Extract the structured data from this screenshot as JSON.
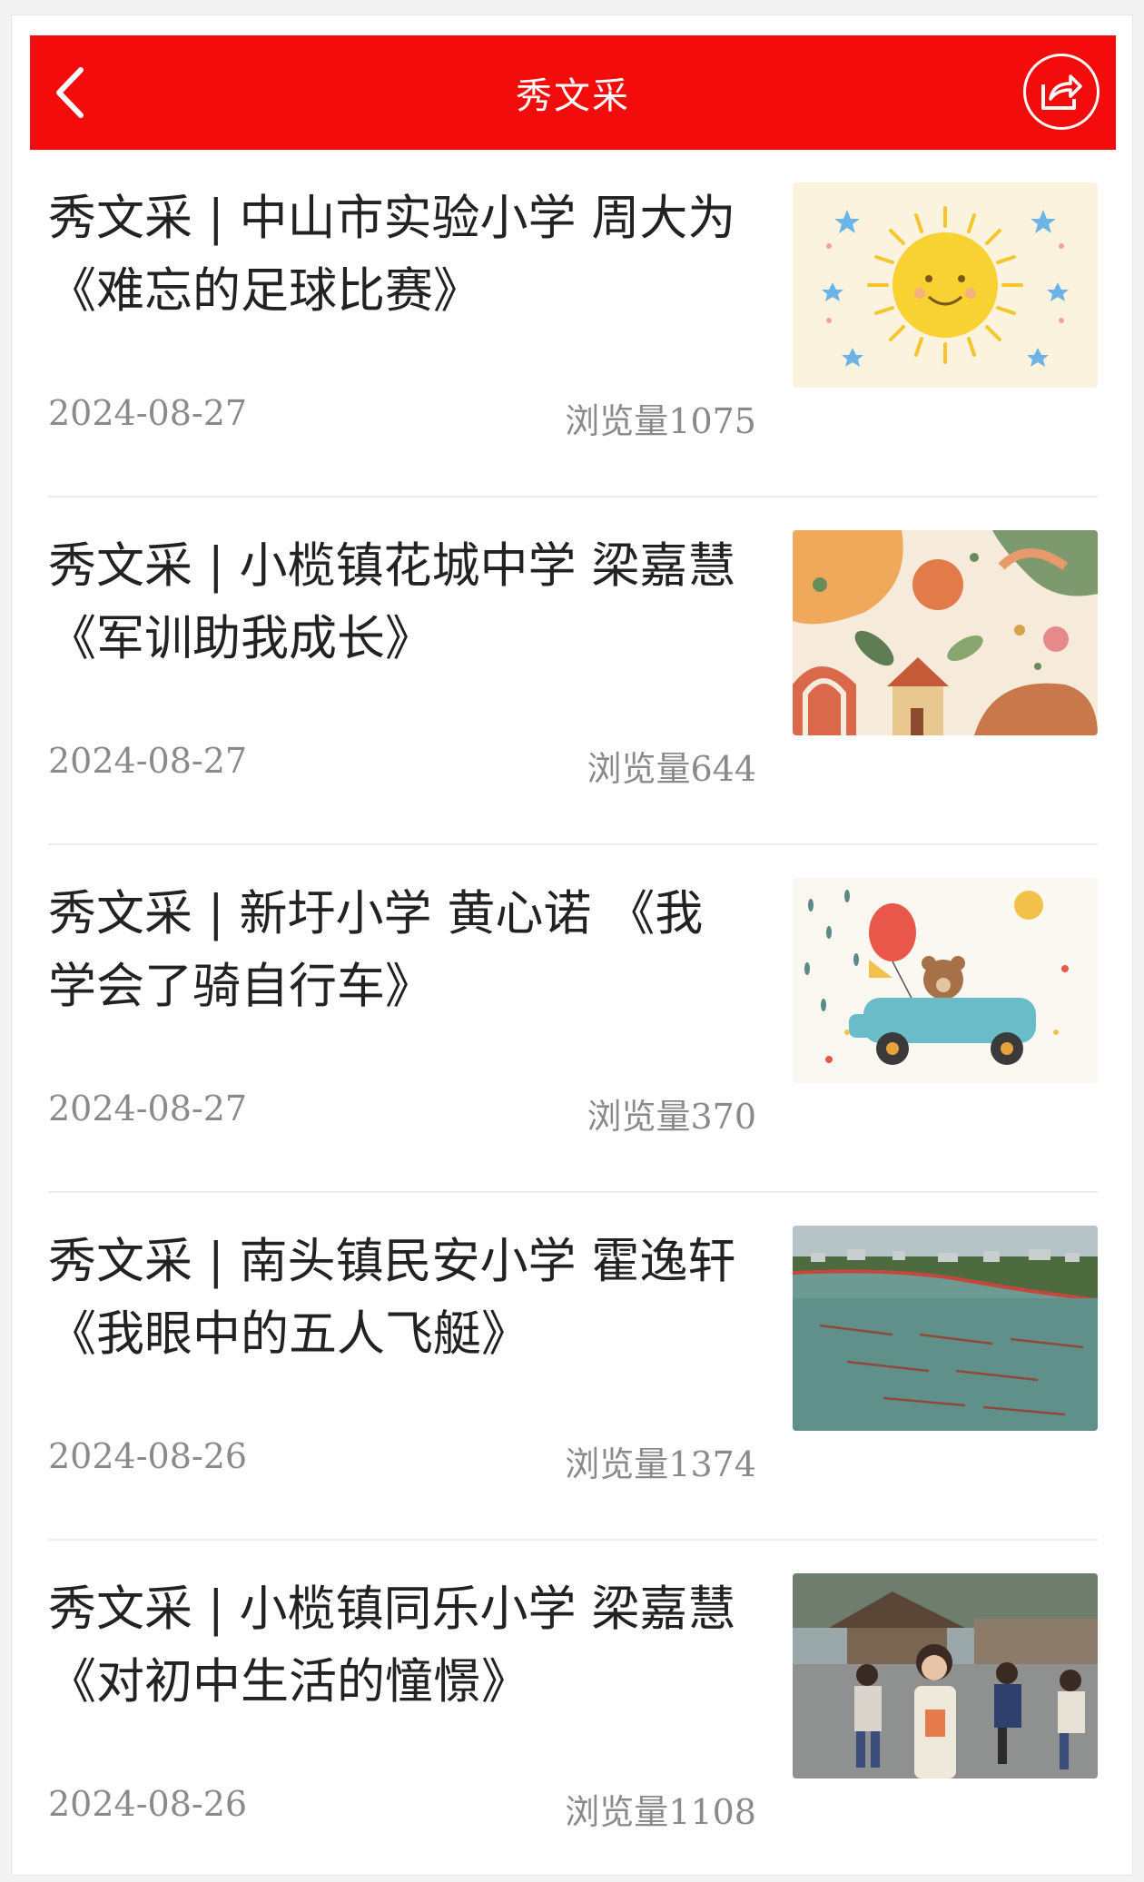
{
  "header": {
    "title": "秀文采",
    "brand_color": "#f40b0b"
  },
  "articles": [
    {
      "title": "秀文采 | 中山市实验小学 周大为 《难忘的足球比赛》",
      "date": "2024-08-27",
      "views": "浏览量1075",
      "thumbnail": "sun-illustration"
    },
    {
      "title": "秀文采 | 小榄镇花城中学 梁嘉慧 《军训助我成长》",
      "date": "2024-08-27",
      "views": "浏览量644",
      "thumbnail": "botanical-pattern"
    },
    {
      "title": "秀文采 | 新圩小学 黄心诺 《我学会了骑自行车》",
      "date": "2024-08-27",
      "views": "浏览量370",
      "thumbnail": "bear-car-illustration"
    },
    {
      "title": "秀文采 | 南头镇民安小学 霍逸轩 《我眼中的五人飞艇》",
      "date": "2024-08-26",
      "views": "浏览量1374",
      "thumbnail": "river-boat-race-photo"
    },
    {
      "title": "秀文采 | 小榄镇同乐小学 梁嘉慧 《对初中生活的憧憬》",
      "date": "2024-08-26",
      "views": "浏览量1108",
      "thumbnail": "students-photo"
    }
  ]
}
